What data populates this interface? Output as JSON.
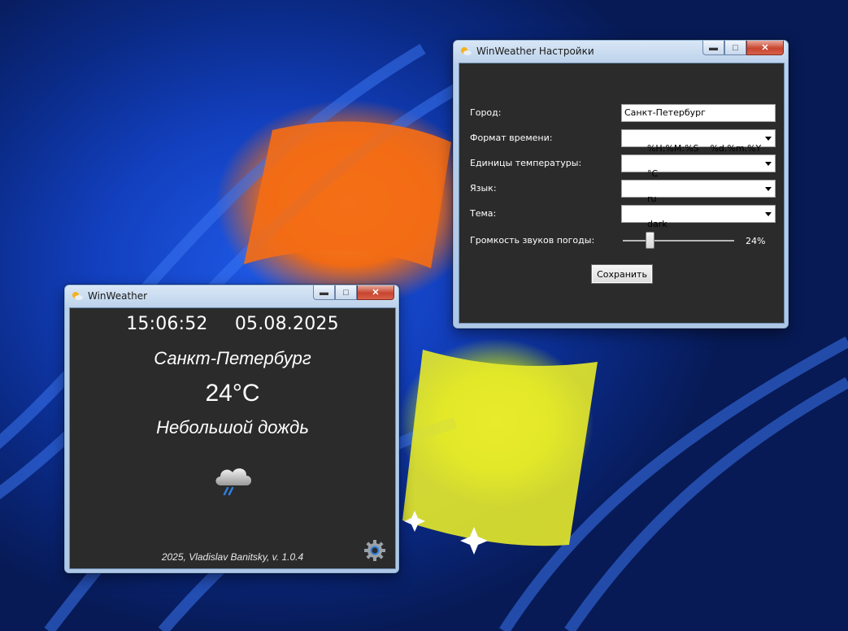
{
  "main_window": {
    "title": "WinWeather",
    "time": "15:06:52",
    "date": "05.08.2025",
    "city": "Санкт-Петербург",
    "temperature": "24°C",
    "description": "Небольшой дождь",
    "weather_icon": "rain-cloud-icon",
    "footer": "2025, Vladislav Banitsky, v. 1.0.4",
    "settings_icon": "gear-icon"
  },
  "settings_window": {
    "title": "WinWeather Настройки",
    "city_label": "Город:",
    "city_value": "Санкт-Петербург",
    "time_format_label": "Формат времени:",
    "time_format_value": "%H:%M:%S    %d.%m.%Y",
    "units_label": "Единицы температуры:",
    "units_value": "°C",
    "language_label": "Язык:",
    "language_value": "ru",
    "theme_label": "Тема:",
    "theme_value": "dark",
    "volume_label": "Громкость звуков погоды:",
    "volume_percent": "24%",
    "volume_level": 0.24,
    "save_label": "Сохранить"
  },
  "colors": {
    "client_background": "#2b2b2b",
    "rain_accent": "#2f7fe0",
    "close_button": "#c8452e"
  }
}
